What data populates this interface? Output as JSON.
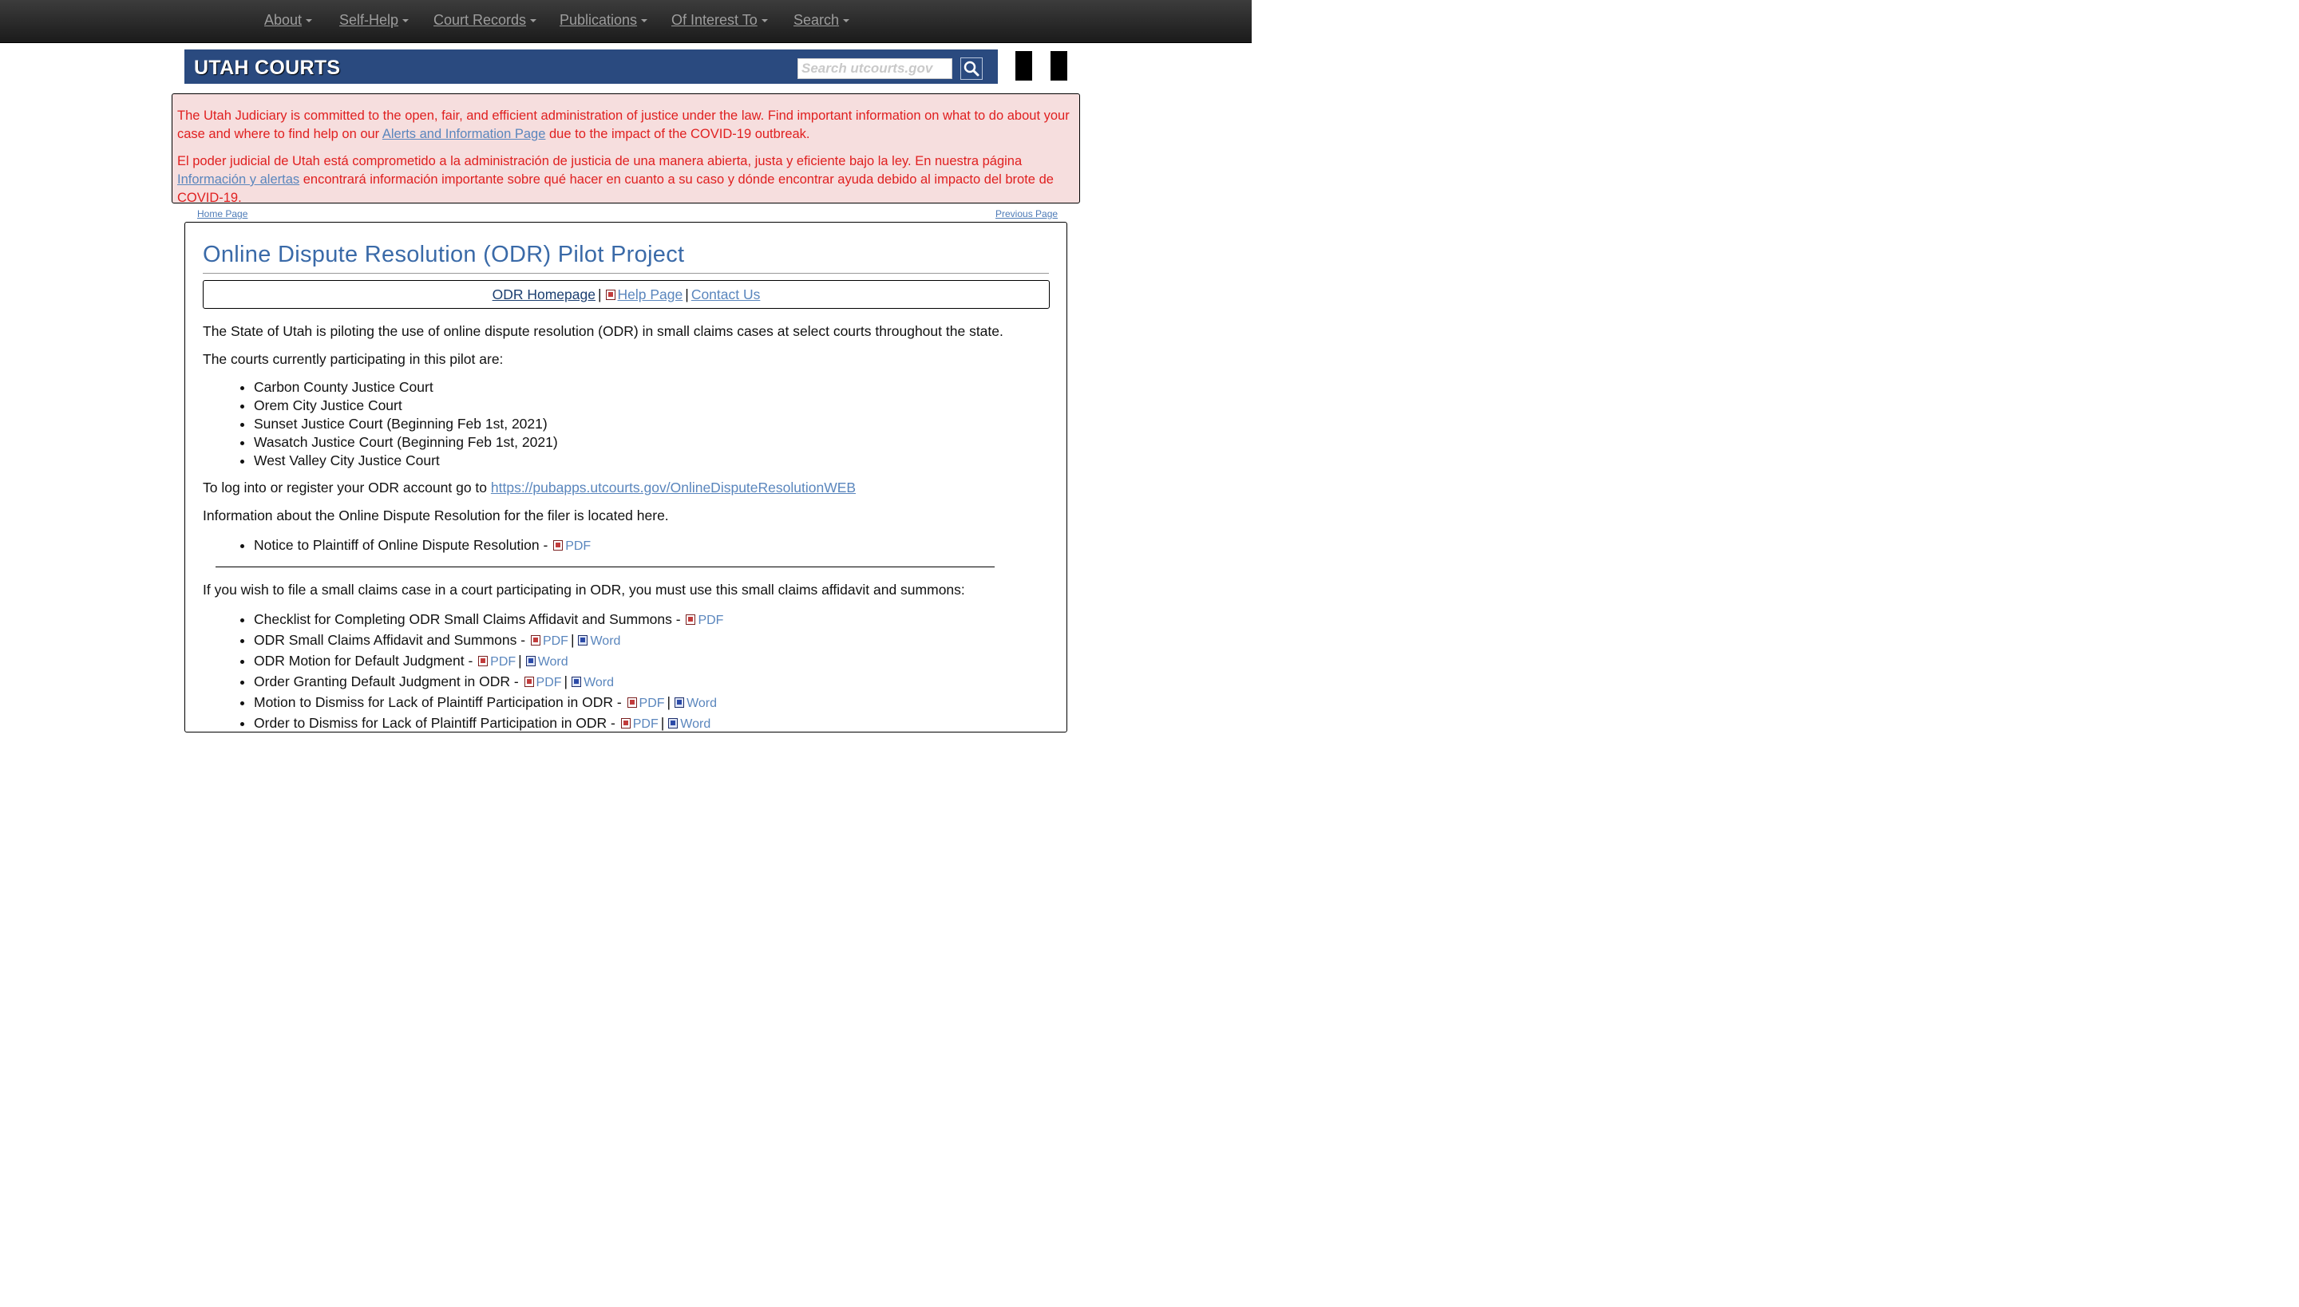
{
  "topnav": {
    "items": [
      {
        "label": "About"
      },
      {
        "label": "Self-Help"
      },
      {
        "label": "Court Records"
      },
      {
        "label": "Publications"
      },
      {
        "label": "Of Interest To"
      },
      {
        "label": "Search"
      }
    ]
  },
  "banner": {
    "brand": "UTAH COURTS",
    "search_placeholder": "Search utcourts.gov"
  },
  "alert": {
    "en_before": "The Utah Judiciary is committed to the open, fair, and efficient administration of justice under the law. Find important information on what to do about your case and where to find help on our ",
    "en_link": "Alerts and Information Page",
    "en_after": " due to the impact of the COVID-19 outbreak.",
    "es_before": "El poder judicial de Utah está comprometido a la administración de justicia de una manera abierta, justa y eficiente bajo la ley. En nuestra página ",
    "es_link": "Información y alertas",
    "es_after": " encontrará información importante sobre qué hacer en cuanto a su caso y dónde encontrar ayuda debido al impacto del brote de COVID-19."
  },
  "breadcrumbs": {
    "home": "Home Page",
    "previous": "Previous Page"
  },
  "main": {
    "title": "Online Dispute Resolution (ODR) Pilot Project",
    "links": {
      "homepage": "ODR Homepage",
      "sep": "|",
      "help": "Help Page",
      "contact": "Contact Us"
    },
    "intro": "The State of Utah is piloting the use of online dispute resolution (ODR) in small claims cases at select courts throughout the state.",
    "courts_heading": "The courts currently participating in this pilot are:",
    "courts": [
      "Carbon County Justice Court",
      "Orem City Justice Court",
      "Sunset Justice Court (Beginning Feb 1st, 2021)",
      "Wasatch Justice Court (Beginning Feb 1st, 2021)",
      "West Valley City Justice Court"
    ],
    "login_text": "To log into or register your ODR account go to ",
    "login_url": "https://pubapps.utcourts.gov/OnlineDisputeResolutionWEB",
    "filer_info": "Information about the Online Dispute Resolution for the filer is located here.",
    "notice": {
      "label": "Notice to Plaintiff of Online Dispute Resolution - ",
      "pdf": "PDF"
    },
    "file_heading": "If you wish to file a small claims case in a court participating in ODR, you must use this small claims affidavit and summons:",
    "forms": [
      {
        "label": "Checklist for Completing ODR Small Claims Affidavit and Summons - ",
        "pdf": "PDF"
      },
      {
        "label": "ODR Small Claims Affidavit and Summons - ",
        "pdf": "PDF",
        "word": "Word"
      },
      {
        "label": "ODR Motion for Default Judgment - ",
        "pdf": "PDF",
        "word": "Word"
      },
      {
        "label": "Order Granting Default Judgment in ODR - ",
        "pdf": "PDF",
        "word": "Word"
      },
      {
        "label": "Motion to Dismiss for Lack of Plaintiff Participation in ODR - ",
        "pdf": "PDF",
        "word": "Word"
      },
      {
        "label": "Order to Dismiss for Lack of Plaintiff Participation in ODR - ",
        "pdf": "PDF",
        "word": "Word"
      }
    ]
  }
}
